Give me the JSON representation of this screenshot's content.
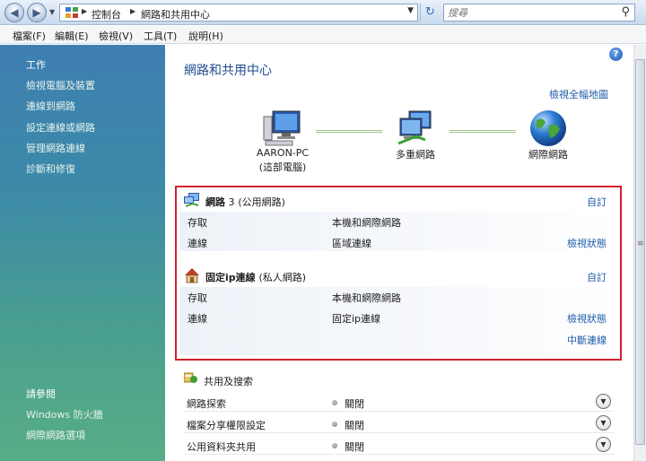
{
  "address": {
    "crumbs": [
      "控制台",
      "網路和共用中心"
    ],
    "search_placeholder": "搜尋"
  },
  "menu": [
    "檔案(F)",
    "編輯(E)",
    "檢視(V)",
    "工具(T)",
    "說明(H)"
  ],
  "tasks": {
    "heading": "工作",
    "items": [
      "檢視電腦及裝置",
      "連線到網路",
      "設定連線或網路",
      "管理網路連線",
      "診斷和修復"
    ],
    "see_also_heading": "請參閱",
    "see_also": [
      "Windows 防火牆",
      "網際網路選項"
    ]
  },
  "main": {
    "title": "網路和共用中心",
    "view_full_map": "檢視全幅地圖",
    "map": {
      "computer_name": "AARON-PC",
      "computer_sub": "(這部電腦)",
      "multi_network": "多重網路",
      "internet": "網際網路"
    },
    "networks": [
      {
        "name": "網路",
        "name_suffix": " 3",
        "type": "(公用網路)",
        "customize": "自訂",
        "access_label": "存取",
        "access_value": "本機和網際網路",
        "connection_label": "連線",
        "connection_value": "區域連線",
        "view_status": "檢視狀態"
      },
      {
        "name": "固定ip連線",
        "name_suffix": "",
        "type": "(私人網路)",
        "customize": "自訂",
        "access_label": "存取",
        "access_value": "本機和網際網路",
        "connection_label": "連線",
        "connection_value": "固定ip連線",
        "view_status": "檢視狀態",
        "disconnect": "中斷連線"
      }
    ],
    "sharing": {
      "heading": "共用及搜索",
      "rows": [
        {
          "label": "網路探索",
          "value": "關閉"
        },
        {
          "label": "檔案分享權限設定",
          "value": "關閉"
        },
        {
          "label": "公用資料夾共用",
          "value": "關閉"
        }
      ]
    }
  }
}
